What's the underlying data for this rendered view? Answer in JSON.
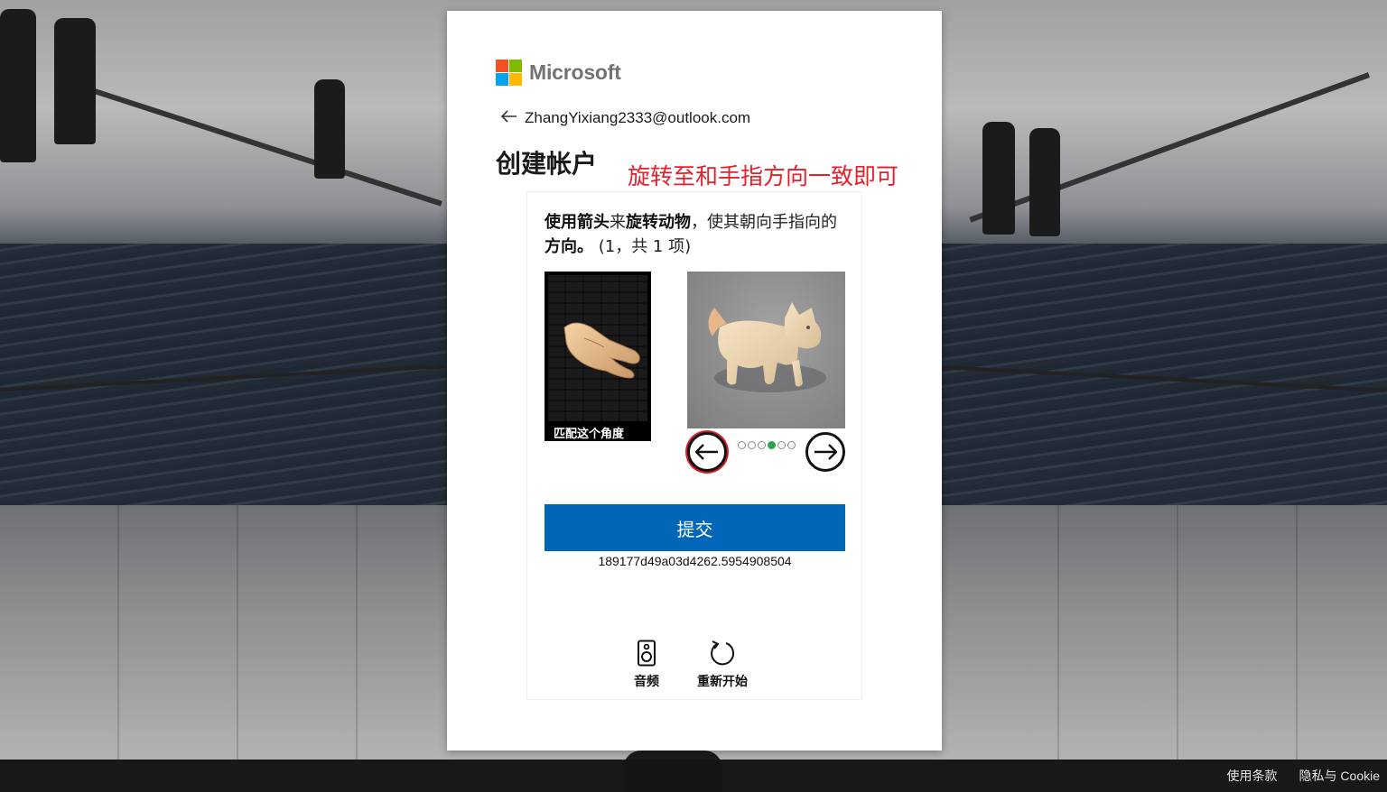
{
  "brand": {
    "name": "Microsoft",
    "colors": [
      "#f25022",
      "#7fba00",
      "#00a4ef",
      "#ffb900"
    ]
  },
  "identity": {
    "back_icon": "arrow-left-icon",
    "email": "ZhangYixiang2333@outlook.com"
  },
  "page": {
    "title": "创建帐户"
  },
  "annotation": {
    "text": "旋转至和手指方向一致即可",
    "color": "#e5202a"
  },
  "captcha": {
    "instruction": {
      "part1_bold": "使用箭头",
      "part2": "来",
      "part3_bold": "旋转动物",
      "part4": "，使其朝向手指向的",
      "part5_bold": "方向。",
      "part6": " (1，共 1 项)"
    },
    "reference_caption": "匹配这个角度",
    "prev_icon": "arrow-left-circle-icon",
    "next_icon": "arrow-right-circle-icon",
    "pagination": {
      "total": 6,
      "active_index": 3,
      "active_color": "#2aa44c"
    },
    "submit_label": "提交",
    "submit_color": "#0067b8",
    "session_id": "189177d49a03d4262.5954908504",
    "audio_label": "音频",
    "audio_icon": "speaker-icon",
    "restart_label": "重新开始",
    "restart_icon": "refresh-icon"
  },
  "footer": {
    "terms": "使用条款",
    "privacy": "隐私与 Cookie"
  }
}
